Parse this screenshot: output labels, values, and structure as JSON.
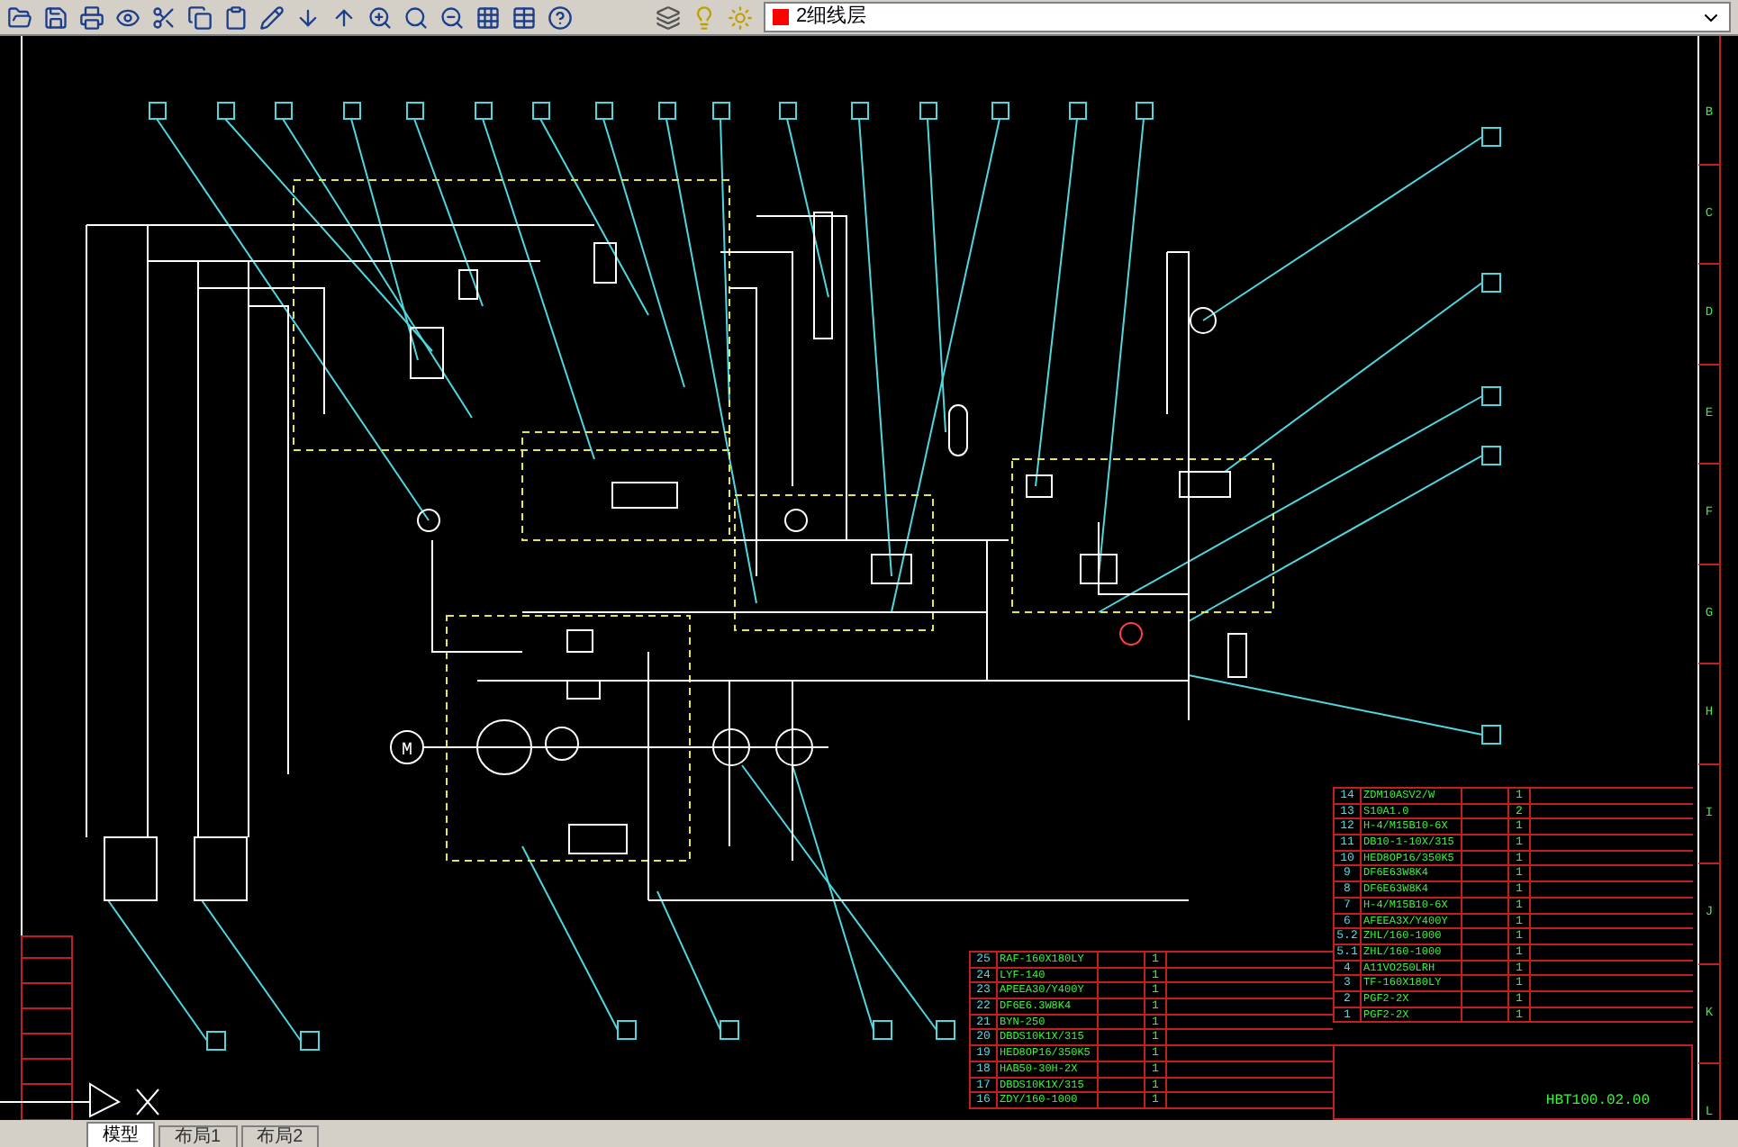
{
  "toolbar": {
    "layer_name": "2细线层"
  },
  "border_rows": [
    "B",
    "C",
    "D",
    "E",
    "F",
    "G",
    "H",
    "I",
    "J",
    "K",
    "L"
  ],
  "motor_label": "M",
  "parts_upper": [
    {
      "no": "14",
      "code": "ZDM10ASV2/W",
      "qty": "1"
    },
    {
      "no": "13",
      "code": "S10A1.0",
      "qty": "2"
    },
    {
      "no": "12",
      "code": "H-4/M15B10-6X",
      "qty": "1"
    },
    {
      "no": "11",
      "code": "DB10-1-10X/315",
      "qty": "1"
    },
    {
      "no": "10",
      "code": "HED8OP16/350K5",
      "qty": "1"
    },
    {
      "no": "9",
      "code": "DF6E63W8K4",
      "qty": "1"
    },
    {
      "no": "8",
      "code": "DF6E63W8K4",
      "qty": "1"
    },
    {
      "no": "7",
      "code": "H-4/M15B10-6X",
      "qty": "1"
    },
    {
      "no": "6",
      "code": "AFEEA3X/Y400Y",
      "qty": "1"
    },
    {
      "no": "5.2",
      "code": "ZHL/160-1000",
      "qty": "1"
    },
    {
      "no": "5.1",
      "code": "ZHL/160-1000",
      "qty": "1"
    },
    {
      "no": "4",
      "code": "A11VO250LRH",
      "qty": "1"
    },
    {
      "no": "3",
      "code": "TF-160X180LY",
      "qty": "1"
    },
    {
      "no": "2",
      "code": "PGF2-2X",
      "qty": "1"
    },
    {
      "no": "1",
      "code": "PGF2-2X",
      "qty": "1"
    }
  ],
  "parts_lower": [
    {
      "no": "25",
      "code": "RAF-160X180LY",
      "qty": "1"
    },
    {
      "no": "24",
      "code": "LYF-140",
      "qty": "1"
    },
    {
      "no": "23",
      "code": "APEEA30/Y400Y",
      "qty": "1"
    },
    {
      "no": "22",
      "code": "DF6E6.3W8K4",
      "qty": "1"
    },
    {
      "no": "21",
      "code": "BYN-250",
      "qty": "1"
    },
    {
      "no": "20",
      "code": "DBDS10K1X/315",
      "qty": "1"
    },
    {
      "no": "19",
      "code": "HED8OP16/350K5",
      "qty": "1"
    },
    {
      "no": "18",
      "code": "HAB50-30H-2X",
      "qty": "1"
    },
    {
      "no": "17",
      "code": "DBDS10K1X/315",
      "qty": "1"
    },
    {
      "no": "16",
      "code": "ZDY/160-1000",
      "qty": "1"
    }
  ],
  "title_block": {
    "drawing_number": "HBT100.02.00"
  },
  "tabs": [
    {
      "label": "模型",
      "selected": true
    },
    {
      "label": "布局1",
      "selected": false
    },
    {
      "label": "布局2",
      "selected": false
    }
  ]
}
